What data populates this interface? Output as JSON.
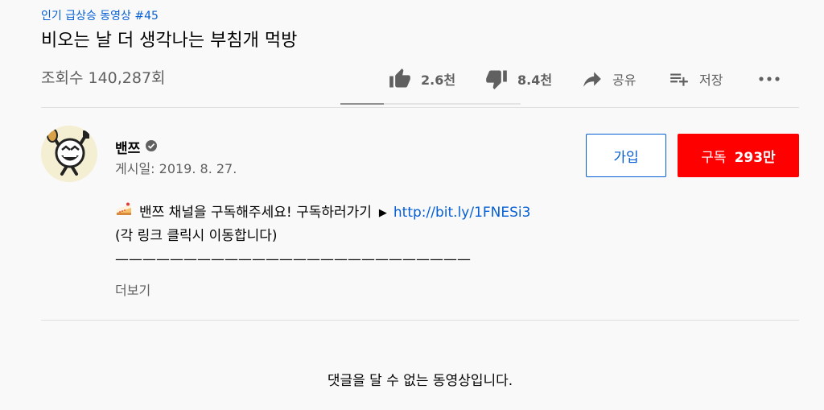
{
  "video": {
    "trending_tag": "인기 급상승 동영상 #45",
    "title": "비오는 날 더 생각나는 부침개 먹방",
    "views": "조회수 140,287회"
  },
  "actions": {
    "like_label": "2.6천",
    "dislike_label": "8.4천",
    "share_label": "공유",
    "save_label": "저장",
    "like_ratio": 0.24
  },
  "channel": {
    "name": "밴쯔",
    "published": "게시일: 2019. 8. 27.",
    "join_label": "가입",
    "subscribe_label": "구독",
    "subscriber_count": "293만"
  },
  "description": {
    "line1_text": "밴쯔 채널을 구독해주세요! 구독하러가기",
    "line1_arrow": "▶",
    "line1_link": "http://bit.ly/1FNESi3",
    "line2": "(각 링크 클릭시 이동합니다)",
    "line3": "——————————————————————————",
    "more_label": "더보기"
  },
  "comments": {
    "disabled_message": "댓글을 달 수 없는 동영상입니다."
  },
  "icons": {
    "like": "thumbs-up-icon",
    "dislike": "thumbs-down-icon",
    "share": "share-arrow-icon",
    "save": "playlist-add-icon",
    "more": "more-horizontal-icon",
    "verified": "verified-check-icon",
    "cake": "cake-emoji-icon"
  },
  "colors": {
    "link": "#065fd4",
    "subscribe": "#ff0000",
    "text_secondary": "#606060"
  }
}
